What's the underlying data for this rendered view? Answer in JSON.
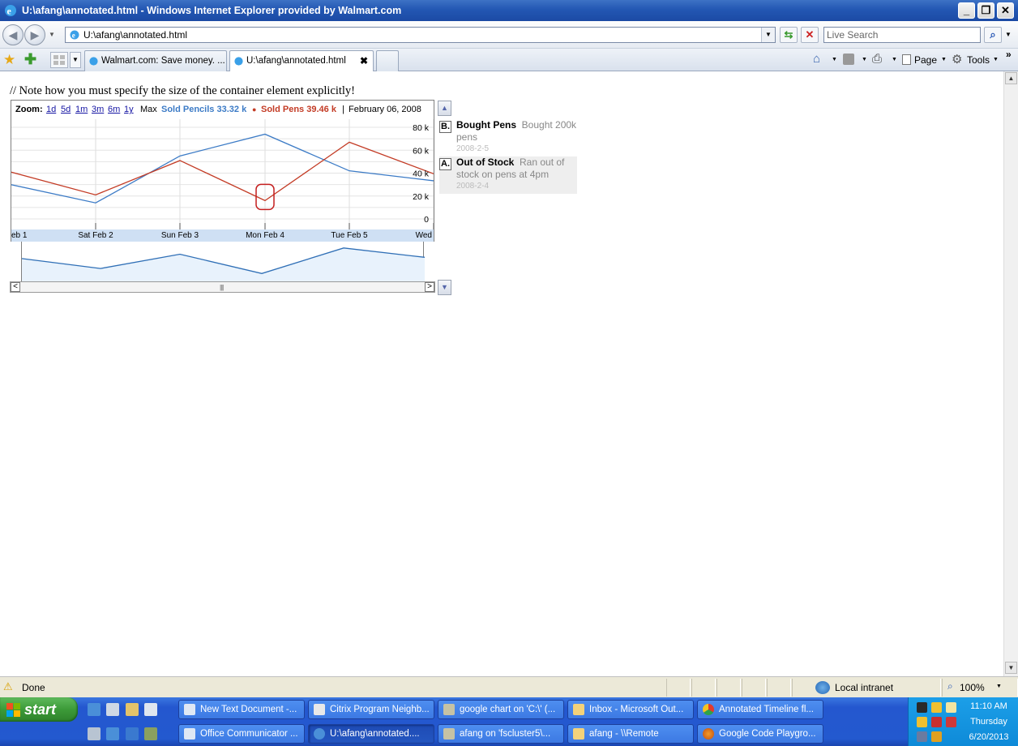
{
  "window": {
    "title": "U:\\afang\\annotated.html - Windows Internet Explorer provided by Walmart.com",
    "min_glyph": "_",
    "restore_glyph": "❐",
    "close_glyph": "✕"
  },
  "address": {
    "url": "U:\\afang\\annotated.html",
    "search_placeholder": "Live Search"
  },
  "tabs": [
    {
      "label": "Walmart.com: Save money. ..."
    },
    {
      "label": "U:\\afang\\annotated.html"
    }
  ],
  "toolbar": {
    "page_label": "Page",
    "tools_label": "Tools"
  },
  "page": {
    "note": "// Note how you must specify the size of the container element explicitly!"
  },
  "chart_data": {
    "type": "line",
    "zoom_label": "Zoom:",
    "zoom_links": [
      "1d",
      "5d",
      "1m",
      "3m",
      "6m",
      "1y"
    ],
    "zoom_max": "Max",
    "legend": [
      {
        "name": "Sold Pencils",
        "value": "33.32 k",
        "color": "#3c7bc6"
      },
      {
        "name": "Sold Pens",
        "value": "39.46 k",
        "color": "#c33b25"
      }
    ],
    "current_date": "February 06, 2008",
    "x_labels": [
      "eb 1",
      "Sat Feb 2",
      "Sun Feb 3",
      "Mon Feb 4",
      "Tue Feb 5",
      "Wed"
    ],
    "y_ticks": [
      "80 k",
      "60 k",
      "40 k",
      "20 k",
      "0"
    ],
    "ylim": [
      0,
      80000
    ],
    "dates": [
      "2008-02-01",
      "2008-02-02",
      "2008-02-03",
      "2008-02-04",
      "2008-02-05",
      "2008-02-06"
    ],
    "series": [
      {
        "name": "Sold Pencils",
        "color": "#3c7bc6",
        "values": [
          30000,
          14000,
          55000,
          74000,
          42000,
          33320
        ]
      },
      {
        "name": "Sold Pens",
        "color": "#c33b25",
        "values": [
          41000,
          21000,
          51000,
          16000,
          67000,
          39460
        ]
      }
    ],
    "annotations": [
      {
        "letter": "B.",
        "title": "Bought Pens",
        "text": "Bought 200k pens",
        "date": "2008-2-5"
      },
      {
        "letter": "A.",
        "title": "Out of Stock",
        "text": "Ran out of stock on pens at 4pm",
        "date": "2008-2-4"
      }
    ],
    "range_values": [
      38000,
      22000,
      45000,
      14000,
      55000,
      40000
    ]
  },
  "statusbar": {
    "status": "Done",
    "zone": "Local intranet",
    "zoom": "100%"
  },
  "taskbar": {
    "start_label": "start",
    "tasks_top": [
      "New Text Document -...",
      "Citrix Program Neighb...",
      "google chart on 'C:\\' (...",
      "Inbox - Microsoft Out...",
      "Annotated Timeline fl..."
    ],
    "tasks_bottom": [
      "Office Communicator ...",
      "U:\\afang\\annotated....",
      "afang on 'fscluster5\\...",
      "afang - \\\\Remote",
      "Google Code Playgro..."
    ],
    "clock": {
      "time": "11:10 AM",
      "day": "Thursday",
      "date": "6/20/2013"
    }
  }
}
